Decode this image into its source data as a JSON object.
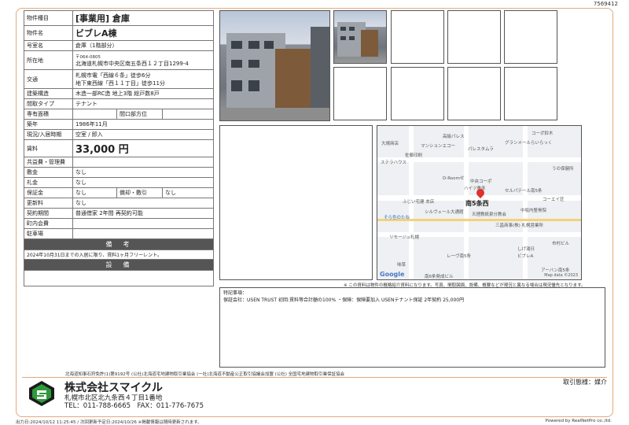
{
  "doc_id": "7569412",
  "spec": {
    "rows": [
      {
        "k": "物件種目",
        "v": "[事業用] 倉庫"
      },
      {
        "k": "物件名",
        "v": "ビブレA棟"
      },
      {
        "k": "号室名",
        "v": "倉庫（1階部分）"
      },
      {
        "k": "所在地",
        "zip": "〒064-0805",
        "v": "北海道札幌市中央区南五条西１２丁目1299-4"
      },
      {
        "k": "交通",
        "v1": "札幌市電「西線６条」徒歩6分",
        "v2": "地下東西線「西１１丁目」徒歩11分"
      },
      {
        "k": "建築構造",
        "v": "木造一部RC造 地上3階 総戸数8戸"
      },
      {
        "k": "間取タイプ",
        "v": "テナント"
      },
      {
        "k": "専有面積",
        "v": "",
        "k2": "間口部方位",
        "v2": ""
      },
      {
        "k": "築年",
        "v": "1986年11月"
      },
      {
        "k": "現況/入居時期",
        "v": "空室 / 即入"
      },
      {
        "k": "賃料",
        "v": "33,000 円"
      },
      {
        "k": "共益費・管理費",
        "v": ""
      },
      {
        "k": "敷金",
        "v": "なし"
      },
      {
        "k": "礼金",
        "v": "なし"
      },
      {
        "k": "保証金",
        "v": "なし",
        "k2": "償却・敷引",
        "v2": "なし"
      },
      {
        "k": "更新料",
        "v": "なし"
      },
      {
        "k": "契約期間",
        "v": "普通借家 2年間 再契約可能"
      },
      {
        "k": "町内会費",
        "v": ""
      },
      {
        "k": "駐車場",
        "v": ""
      }
    ],
    "biko_title": "備　考",
    "biko_text": "2024年10月31日までの入居に限り、賃料1ヶ月フリーレント。",
    "setsubi_title": "設　備"
  },
  "map": {
    "labels": [
      "高級パレス",
      "コーポ鈴木",
      "マンションエコー",
      "パレスタムラ",
      "グランメールらいらっく",
      "佐藤印刷",
      "大規商店",
      "ステラハウス",
      "うの保健所",
      "D-Roomせ",
      "中央コーポ",
      "ハイツ雅彦",
      "セルパテール南5条",
      "ふじい宅建 本店",
      "南5条西",
      "コーエイ荘",
      "シルヴェール大通館",
      "天理教統泉分教会",
      "中坂内整骨院",
      "そら色のたね",
      "三昌商事(株) 札幌営業所",
      "リモージュ札幌",
      "市村ビル",
      "レーヴ南5条",
      "しげ湯日",
      "ビブレA",
      "味菜",
      "アーバン南5条",
      "南6条発成ビル"
    ],
    "google": "Google",
    "mapdata": "Map data ©2023"
  },
  "disclaimer": "※ この資料は物件の概略紹介資料になります。写真、間取図面、設備、概要などが現況と異なる場合は現況優先となります。",
  "remarks": {
    "title": "特記事項：",
    "text": "保証会社：USEN TRUST 初回:賃料等合計額の100% ・保険：保険要加入 USENテナント保証 2年契約 25,000円"
  },
  "footer": {
    "assoc": "北海道知事石狩免許(1)第9192号 (公社)北海道宅地建物取引業協会 (一社)北海道不動産公正取引協議会加盟 (公社) 全国宅地建物取引業保証協会",
    "company": "株式会社スマイクル",
    "address": "札幌市北区北九条西４丁目1番地",
    "tel": "TEL：011-788-6665　FAX：011-776-7675",
    "trade_type": "取引態様：媒介",
    "printed": "出力日:2024/10/12 11:25:45 / 次回更新予定日:2024/10/26 ※掲載情報は随時更新されます。",
    "powered": "Powered by RealNetPro co.,ltd."
  },
  "colors": {
    "frame": "#e3a87a",
    "bar": "#555555",
    "logo_green": "#2f9a3c"
  }
}
